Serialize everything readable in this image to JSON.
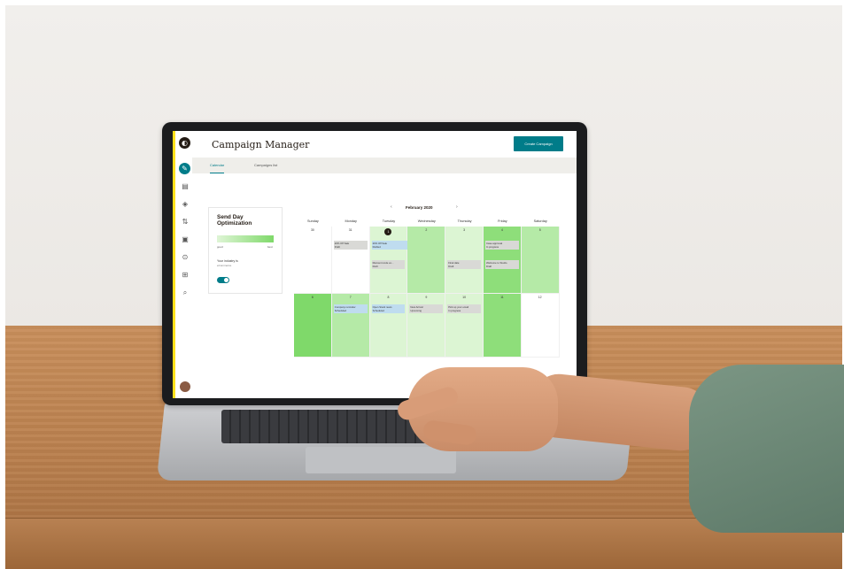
{
  "app": {
    "title": "Campaign Manager",
    "create_button": "Create Campaign",
    "logo_glyph": "◐"
  },
  "sidebar": {
    "items": [
      {
        "name": "create",
        "icon": "pencil-icon",
        "glyph": "✎"
      },
      {
        "name": "audience",
        "icon": "audience-icon",
        "glyph": "▤"
      },
      {
        "name": "campaigns",
        "icon": "campaigns-icon",
        "glyph": "◈"
      },
      {
        "name": "automations",
        "icon": "automations-icon",
        "glyph": "⇅"
      },
      {
        "name": "website",
        "icon": "website-icon",
        "glyph": "▣"
      },
      {
        "name": "content",
        "icon": "content-icon",
        "glyph": "⊙"
      },
      {
        "name": "integrations",
        "icon": "integrations-icon",
        "glyph": "⊞"
      },
      {
        "name": "search",
        "icon": "search-icon",
        "glyph": "⌕"
      }
    ]
  },
  "tabs": [
    {
      "label": "Calendar",
      "active": true
    },
    {
      "label": "Campaigns list",
      "active": false
    }
  ],
  "send_day_optimization": {
    "title": "Send Day Optimization",
    "scale_low": "good",
    "scale_high": "best",
    "industry_label": "Your industry is",
    "industry_value": "eCommerce",
    "toggle_on": true
  },
  "calendar": {
    "month": "February 2020",
    "prev": "‹",
    "next": "›",
    "weekdays": [
      "Sunday",
      "Monday",
      "Tuesday",
      "Wednesday",
      "Thursday",
      "Friday",
      "Saturday"
    ],
    "week1": [
      "30",
      "31",
      "1",
      "2",
      "3",
      "4",
      "5"
    ],
    "week2": [
      "6",
      "7",
      "8",
      "9",
      "10",
      "11",
      "12"
    ],
    "events": {
      "e1": "20% Off Sale",
      "e1s": "Draft",
      "e2": "20% Off Sale",
      "e2s": "Drafted",
      "e3": "Discount code ex...",
      "e3s": "Draft",
      "e4": "Final date",
      "e4s": "Draft",
      "e5": "Case approval",
      "e5s": "In progress",
      "e6": "Welcome to Studio",
      "e6s": "Draft",
      "e7": "Company reminder",
      "e7s": "Scheduled",
      "e8": "Open Stock news",
      "e8s": "Scheduled",
      "e9": "New Arrival",
      "e9s": "Upcoming",
      "e10": "Pick up your email",
      "e10s": "In progress"
    }
  },
  "colors": {
    "accent": "#007c89",
    "brand_yellow": "#ffe01b",
    "green_strong": "#8ede7a",
    "green_mid": "#b5eaa7",
    "green_light": "#dcf5d3"
  }
}
